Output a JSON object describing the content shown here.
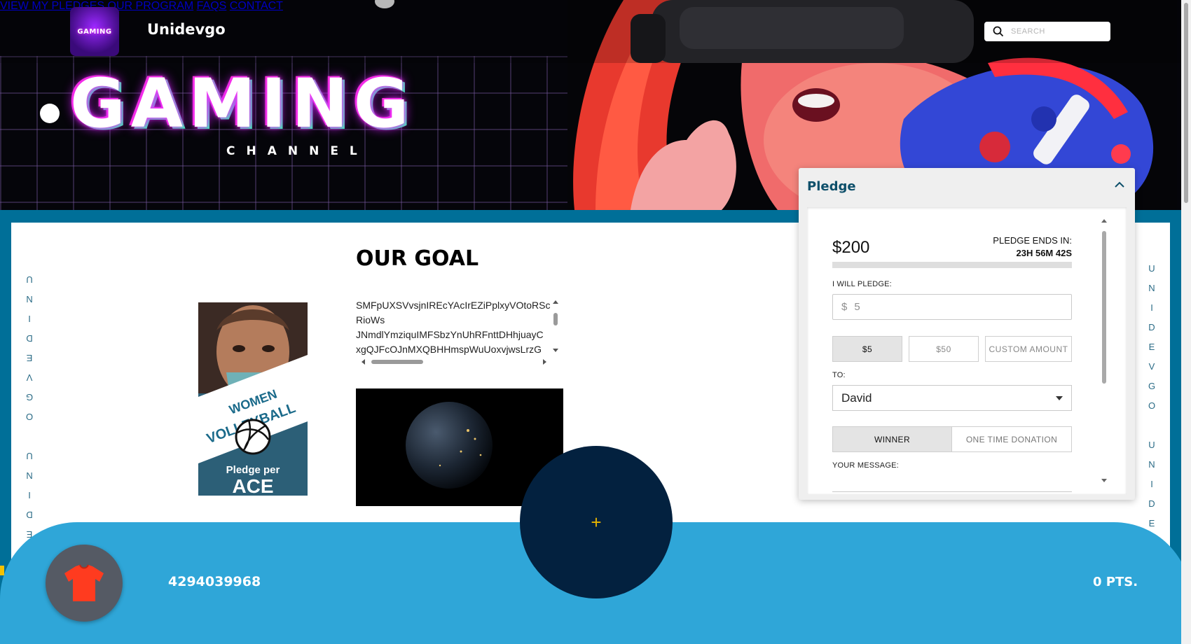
{
  "header": {
    "logo_text": "GAMING",
    "brand": "Unidevgo",
    "nav": [
      "VIEW MY PLEDGES",
      "OUR PROGRAM",
      "FAQS",
      "CONTACT"
    ],
    "search_placeholder": "SEARCH"
  },
  "hero": {
    "title": "GAMING",
    "subtitle": "CHANNEL"
  },
  "side_text": {
    "left": "UNIDEVGO UNIDE",
    "right": "UNIDEVGO UNIDE"
  },
  "main": {
    "goal_title": "OUR GOAL",
    "poster": {
      "line1": "WOMEN",
      "line2": "VOLLEYBALL",
      "line3": "Pledge per",
      "line4": "ACE"
    },
    "text_lines": [
      "SMFpUXSVvsjnIREcYAcIrEZiPplxyVOtoRSc",
      "RioWs",
      "JNmdlYmziquIMFSbzYnUhRFnttDHhjuayC",
      "xgQJFcOJnMXQBHHmspWuUoxvjwsLrzG"
    ]
  },
  "pledge": {
    "title": "Pledge",
    "amount": "$200",
    "ends_label": "PLEDGE ENDS IN:",
    "ends_value": "23H 56M 42S",
    "progress": 0,
    "will_pledge_label": "I WILL PLEDGE:",
    "currency": "$",
    "input_value": "5",
    "amount_options": [
      "$5",
      "$50",
      "CUSTOM AMOUNT"
    ],
    "selected_amount": "$5",
    "to_label": "TO:",
    "to_value": "David",
    "toggle_options": [
      "WINNER",
      "ONE TIME DONATION"
    ],
    "selected_toggle": "WINNER",
    "message_label": "YOUR MESSAGE:"
  },
  "footer": {
    "user_id": "4294039968",
    "points": "0 PTS.",
    "fab_label": "+"
  },
  "colors": {
    "frame": "#006f98",
    "footer": "#2fa6d8",
    "fab": "#03213f",
    "pledge_title": "#0d4f6a"
  }
}
